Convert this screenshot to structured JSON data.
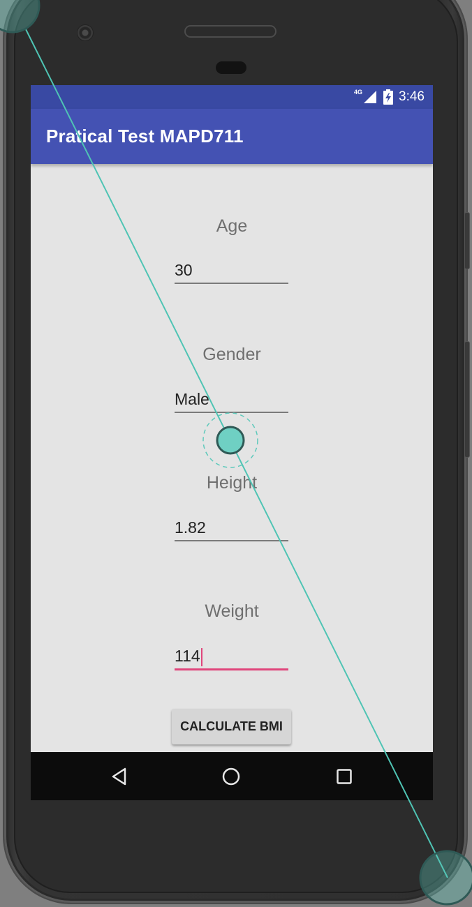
{
  "status_bar": {
    "network": "4G",
    "time": "3:46"
  },
  "app_bar": {
    "title": "Pratical Test MAPD711"
  },
  "form": {
    "age": {
      "label": "Age",
      "value": "30"
    },
    "gender": {
      "label": "Gender",
      "value": "Male"
    },
    "height": {
      "label": "Height",
      "value": "1.82"
    },
    "weight": {
      "label": "Weight",
      "value": "114"
    }
  },
  "calculate_button": {
    "label": "CALCULATE BMI"
  },
  "nav_bar": {
    "back_icon": "back-triangle-icon",
    "home_icon": "home-circle-icon",
    "recents_icon": "recents-square-icon"
  },
  "colors": {
    "status_bar": "#3949a3",
    "app_bar": "#4452b3",
    "screen_background": "#e4e4e4",
    "focus_accent": "#e0457b",
    "touch_overlay": "#5ec9bb",
    "nav_bar": "#0c0c0c"
  }
}
